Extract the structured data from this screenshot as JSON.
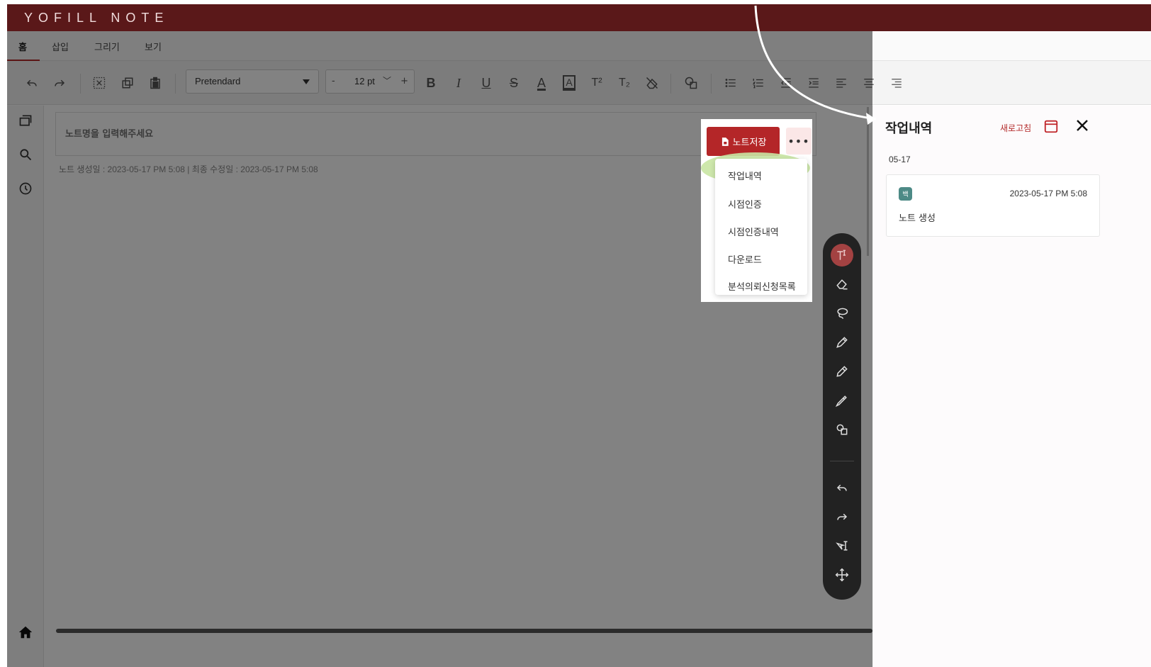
{
  "app": {
    "title": "YOFILL NOTE"
  },
  "menu_tabs": [
    "홈",
    "삽입",
    "그리기",
    "보기"
  ],
  "toolbar": {
    "font_family": "Pretendard",
    "font_size": "12 pt",
    "size_minus": "-",
    "size_plus": "+",
    "bold_label": "B",
    "italic_label": "I",
    "underline_label": "U",
    "strike_label": "S",
    "font_color_label": "A",
    "highlight_label": "A",
    "superscript_label": "T²",
    "subscript_label": "T₂"
  },
  "editor": {
    "title_placeholder": "노트명을 입력해주세요",
    "meta": "노트 생성일 : 2023-05-17 PM 5:08  |  최종 수정일 : 2023-05-17 PM 5:08"
  },
  "popover": {
    "save_label": "노트저장",
    "more_label": "•••",
    "menu_items": [
      "작업내역",
      "시점인증",
      "시점인증내역",
      "다운로드",
      "분석의뢰신청목록"
    ]
  },
  "panel": {
    "title": "작업내역",
    "refresh_label": "새로고침",
    "date_group": "05-17",
    "entries": [
      {
        "badge": "백",
        "time": "2023-05-17 PM 5:08",
        "description": "노트 생성"
      }
    ]
  },
  "colors": {
    "brand_bar": "#5a1819",
    "accent_red": "#b42628",
    "highlight_green": "#c9e5a3",
    "badge_teal": "#4d8a86"
  }
}
